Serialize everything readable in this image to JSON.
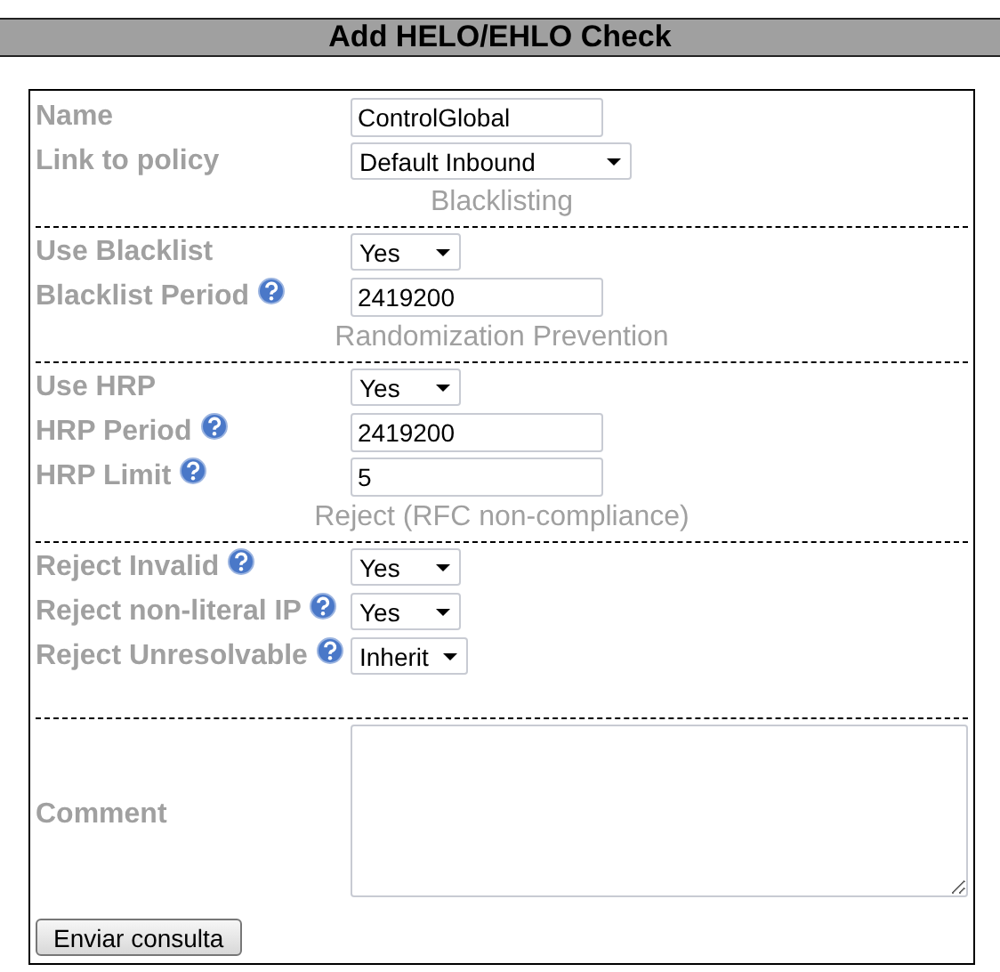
{
  "title": "Add HELO/EHLO Check",
  "sections": [
    {
      "rows": [
        {
          "label": "Name",
          "kind": "text",
          "value": "ControlGlobal",
          "help": false
        },
        {
          "label": "Link to policy",
          "kind": "select",
          "value": "Default Inbound",
          "help": false
        }
      ]
    },
    {
      "heading": "Blacklisting",
      "rows": [
        {
          "label": "Use Blacklist",
          "kind": "select",
          "value": "Yes",
          "help": false
        },
        {
          "label": "Blacklist Period",
          "kind": "text",
          "value": "2419200",
          "help": true
        }
      ]
    },
    {
      "heading": "Randomization Prevention",
      "rows": [
        {
          "label": "Use HRP",
          "kind": "select",
          "value": "Yes",
          "help": false
        },
        {
          "label": "HRP Period",
          "kind": "text",
          "value": "2419200",
          "help": true
        },
        {
          "label": "HRP Limit",
          "kind": "text",
          "value": "5",
          "help": true
        }
      ]
    },
    {
      "heading": "Reject (RFC non-compliance)",
      "rows": [
        {
          "label": "Reject Invalid",
          "kind": "select",
          "value": "Yes",
          "help": true
        },
        {
          "label": "Reject non-literal IP",
          "kind": "select",
          "value": "Yes",
          "help": true
        },
        {
          "label": "Reject Unresolvable",
          "kind": "select",
          "value": "Inherit",
          "help": true
        }
      ]
    },
    {
      "rows": [
        {
          "label": "Comment",
          "kind": "textarea",
          "value": "",
          "help": false
        }
      ]
    }
  ],
  "button": "Enviar consulta"
}
